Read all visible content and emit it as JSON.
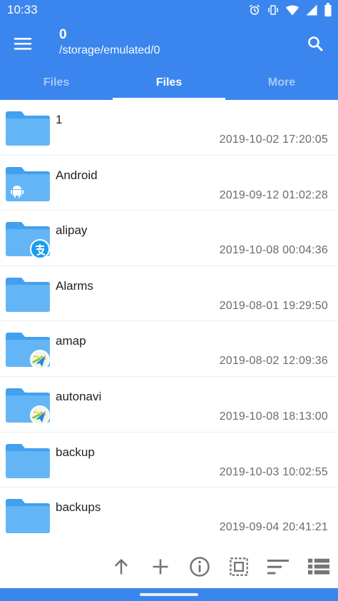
{
  "status_bar": {
    "time": "10:33",
    "icons": [
      "alarm-icon",
      "vibrate-icon",
      "wifi-icon",
      "signal-icon",
      "battery-icon"
    ]
  },
  "app_bar": {
    "title": "0",
    "subtitle": "/storage/emulated/0",
    "menu_icon": "menu-icon",
    "search_icon": "search-icon"
  },
  "tabs": [
    {
      "label": "Files",
      "active": false
    },
    {
      "label": "Files",
      "active": true
    },
    {
      "label": "More",
      "active": false
    }
  ],
  "files": [
    {
      "name": "1",
      "date": "2019-10-02 17:20:05",
      "badge": null
    },
    {
      "name": "Android",
      "date": "2019-09-12 01:02:28",
      "badge": "android-icon"
    },
    {
      "name": "alipay",
      "date": "2019-10-08 00:04:36",
      "badge": "alipay-icon"
    },
    {
      "name": "Alarms",
      "date": "2019-08-01 19:29:50",
      "badge": null
    },
    {
      "name": "amap",
      "date": "2019-08-02 12:09:36",
      "badge": "amap-icon"
    },
    {
      "name": "autonavi",
      "date": "2019-10-08 18:13:00",
      "badge": "amap-icon"
    },
    {
      "name": "backup",
      "date": "2019-10-03 10:02:55",
      "badge": null
    },
    {
      "name": "backups",
      "date": "2019-09-04 20:41:21",
      "badge": null
    }
  ],
  "toolbar": {
    "icons": [
      "arrow-up-icon",
      "plus-icon",
      "info-icon",
      "select-all-icon",
      "sort-icon",
      "view-list-icon"
    ]
  },
  "colors": {
    "primary": "#3b86ee",
    "folder": "#64b5f6",
    "folder_dark": "#42a0ef",
    "icon_gray": "#757575"
  }
}
